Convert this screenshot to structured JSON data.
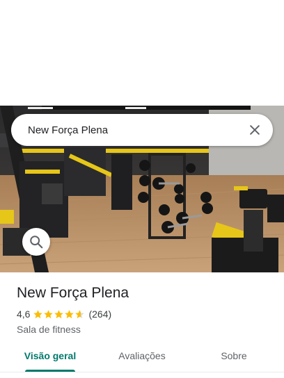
{
  "search": {
    "query": "New Força Plena",
    "search_icon": "search-icon",
    "close_icon": "close-icon"
  },
  "photo": {
    "subject": "gym-interior-photo"
  },
  "place": {
    "name": "New Força Plena",
    "rating": "4,6",
    "rating_numeric": 4.6,
    "star_count": 5,
    "reviews": "(264)",
    "category": "Sala de fitness"
  },
  "tabs": [
    {
      "label": "Visão geral",
      "active": true
    },
    {
      "label": "Avaliações",
      "active": false
    },
    {
      "label": "Sobre",
      "active": false
    }
  ],
  "colors": {
    "accent": "#00796b",
    "star": "#fbbc04",
    "text": "#202124",
    "muted": "#5f6368"
  }
}
